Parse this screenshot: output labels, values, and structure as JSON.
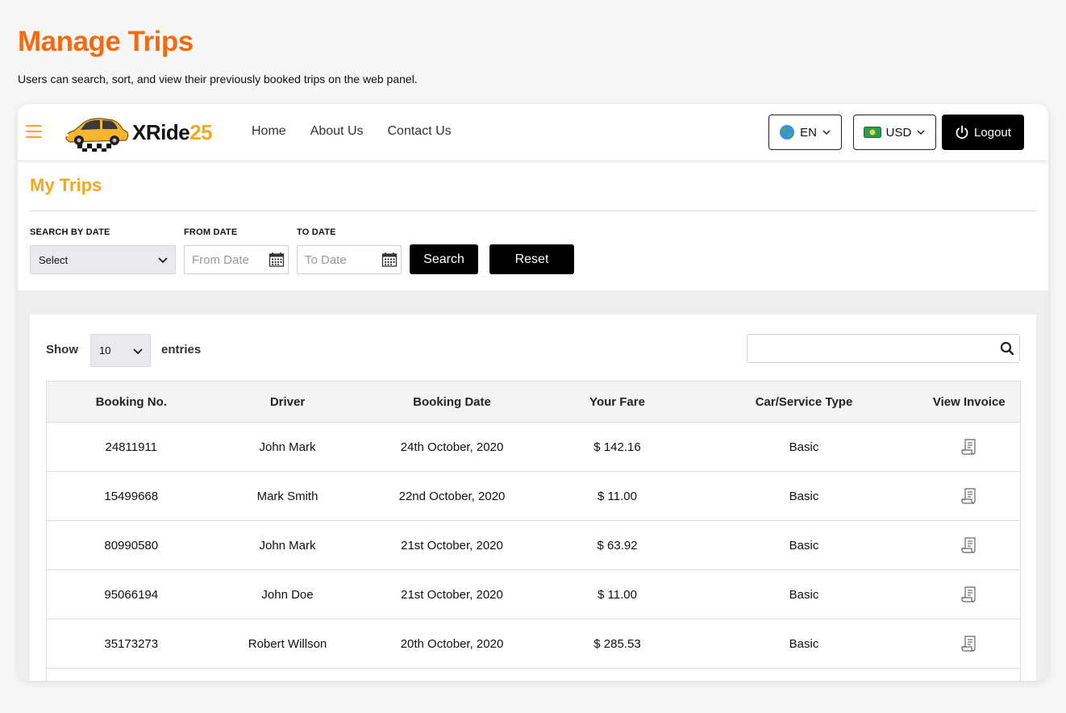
{
  "page": {
    "title": "Manage Trips",
    "subtitle": "Users can search, sort, and view their previously booked trips on the web panel."
  },
  "navbar": {
    "logo_text_main": "XRide",
    "logo_text_accent": "25",
    "links": [
      "Home",
      "About Us",
      "Contact Us"
    ],
    "language": "EN",
    "currency": "USD",
    "logout_label": "Logout"
  },
  "filters": {
    "section_title": "My Trips",
    "search_by_date_label": "SEARCH BY DATE",
    "search_by_date_value": "Select",
    "from_date_label": "FROM DATE",
    "from_date_placeholder": "From Date",
    "to_date_label": "TO DATE",
    "to_date_placeholder": "To Date",
    "search_button": "Search",
    "reset_button": "Reset"
  },
  "list": {
    "show_label": "Show",
    "entries_value": "10",
    "entries_label": "entries",
    "search_value": ""
  },
  "table": {
    "headers": [
      "Booking No.",
      "Driver",
      "Booking Date",
      "Your Fare",
      "Car/Service Type",
      "View Invoice"
    ],
    "rows": [
      {
        "booking_no": "24811911",
        "driver": "John Mark",
        "date": "24th October, 2020",
        "fare": "$ 142.16",
        "type": "Basic"
      },
      {
        "booking_no": "15499668",
        "driver": "Mark Smith",
        "date": "22nd October, 2020",
        "fare": "$ 11.00",
        "type": "Basic"
      },
      {
        "booking_no": "80990580",
        "driver": "John Mark",
        "date": "21st October, 2020",
        "fare": "$ 63.92",
        "type": "Basic"
      },
      {
        "booking_no": "95066194",
        "driver": "John Doe",
        "date": "21st October, 2020",
        "fare": "$ 11.00",
        "type": "Basic"
      },
      {
        "booking_no": "35173273",
        "driver": "Robert Willson",
        "date": "20th October, 2020",
        "fare": "$ 285.53",
        "type": "Basic"
      }
    ]
  },
  "colors": {
    "title_orange": "#f26b13",
    "accent_yellow": "#f5a623",
    "button_black": "#000000"
  },
  "icons": [
    "hamburger-icon",
    "car-logo-icon",
    "globe-icon",
    "chevron-down-icon",
    "money-icon",
    "power-icon",
    "calendar-icon",
    "search-icon",
    "invoice-icon"
  ]
}
